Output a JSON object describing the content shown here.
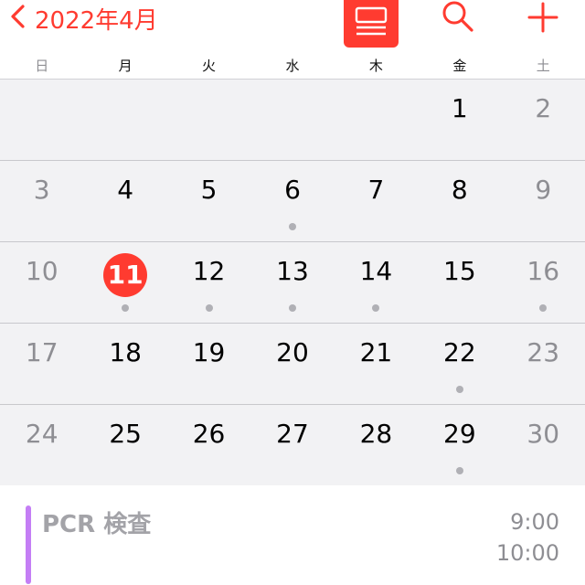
{
  "nav": {
    "back_label": "2022年4月",
    "back_icon": "chevron-left-icon",
    "list_icon": "list-view-icon",
    "search_icon": "search-icon",
    "add_icon": "plus-icon",
    "accent_color": "#ff3b30"
  },
  "weekdays": [
    "日",
    "月",
    "火",
    "水",
    "木",
    "金",
    "土"
  ],
  "weeks": [
    [
      {
        "d": ""
      },
      {
        "d": ""
      },
      {
        "d": ""
      },
      {
        "d": ""
      },
      {
        "d": ""
      },
      {
        "d": "1"
      },
      {
        "d": "2"
      }
    ],
    [
      {
        "d": "3"
      },
      {
        "d": "4"
      },
      {
        "d": "5"
      },
      {
        "d": "6",
        "dot": true
      },
      {
        "d": "7"
      },
      {
        "d": "8"
      },
      {
        "d": "9"
      }
    ],
    [
      {
        "d": "10"
      },
      {
        "d": "11",
        "today": true,
        "dot": true
      },
      {
        "d": "12",
        "dot": true
      },
      {
        "d": "13",
        "dot": true
      },
      {
        "d": "14",
        "dot": true
      },
      {
        "d": "15"
      },
      {
        "d": "16",
        "dot": true
      }
    ],
    [
      {
        "d": "17"
      },
      {
        "d": "18"
      },
      {
        "d": "19"
      },
      {
        "d": "20"
      },
      {
        "d": "21"
      },
      {
        "d": "22",
        "dot": true
      },
      {
        "d": "23"
      }
    ],
    [
      {
        "d": "24"
      },
      {
        "d": "25"
      },
      {
        "d": "26"
      },
      {
        "d": "27"
      },
      {
        "d": "28"
      },
      {
        "d": "29",
        "dot": true
      },
      {
        "d": "30"
      }
    ]
  ],
  "event": {
    "title": "PCR 検査",
    "start": "9:00",
    "end": "10:00",
    "color": "#c47ef5"
  }
}
